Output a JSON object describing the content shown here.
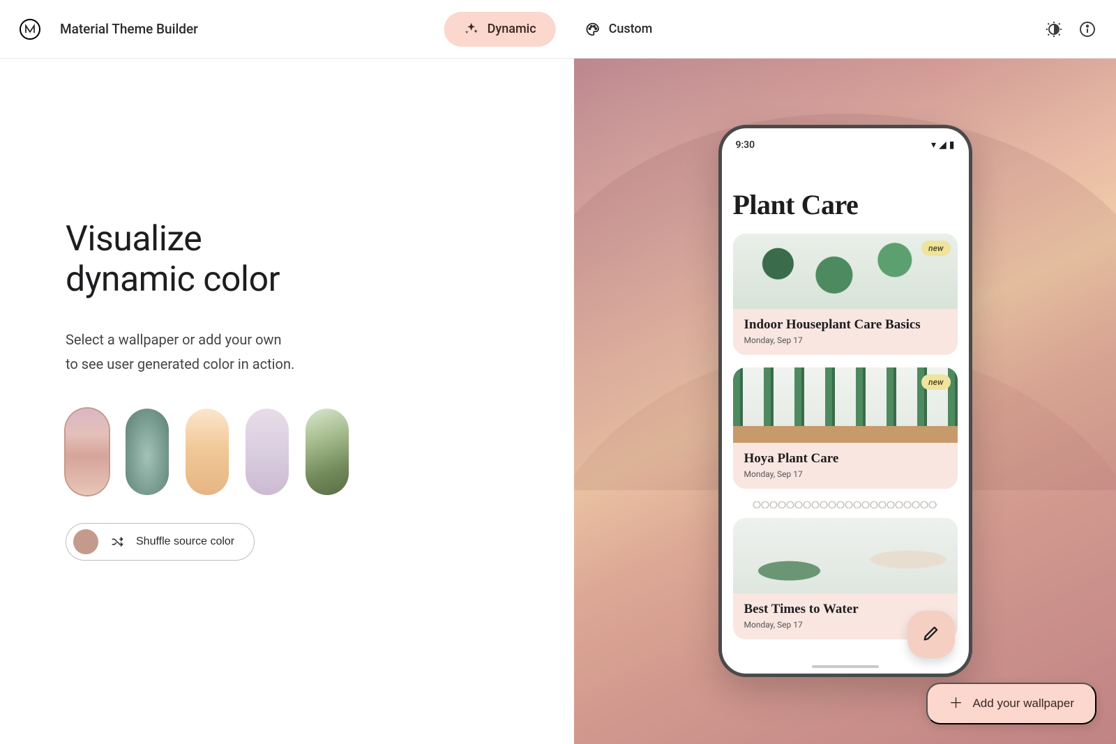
{
  "header": {
    "app_title": "Material Theme Builder",
    "tabs": {
      "dynamic": "Dynamic",
      "custom": "Custom",
      "active": "dynamic"
    }
  },
  "hero": {
    "title_line1": "Visualize",
    "title_line2": "dynamic color",
    "sub_line1": "Select a wallpaper or add your own",
    "sub_line2": "to see user generated color in action."
  },
  "shuffle": {
    "label": "Shuffle source color",
    "source_color": "#c49a8c"
  },
  "wallpapers": {
    "selected_index": 0,
    "items": [
      "pink-desert",
      "green-rock",
      "orange-dunes",
      "lavender-mountains",
      "green-hills"
    ]
  },
  "preview": {
    "time": "9:30",
    "app_title": "Plant Care",
    "cards": [
      {
        "title": "Indoor Houseplant Care Basics",
        "date": "Monday, Sep 17",
        "badge": "new"
      },
      {
        "title": "Hoya Plant Care",
        "date": "Monday, Sep 17",
        "badge": "new"
      },
      {
        "title": "Best Times to Water",
        "date": "Monday, Sep 17",
        "badge": ""
      }
    ]
  },
  "fab": {
    "add_wallpaper_label": "Add your wallpaper"
  }
}
